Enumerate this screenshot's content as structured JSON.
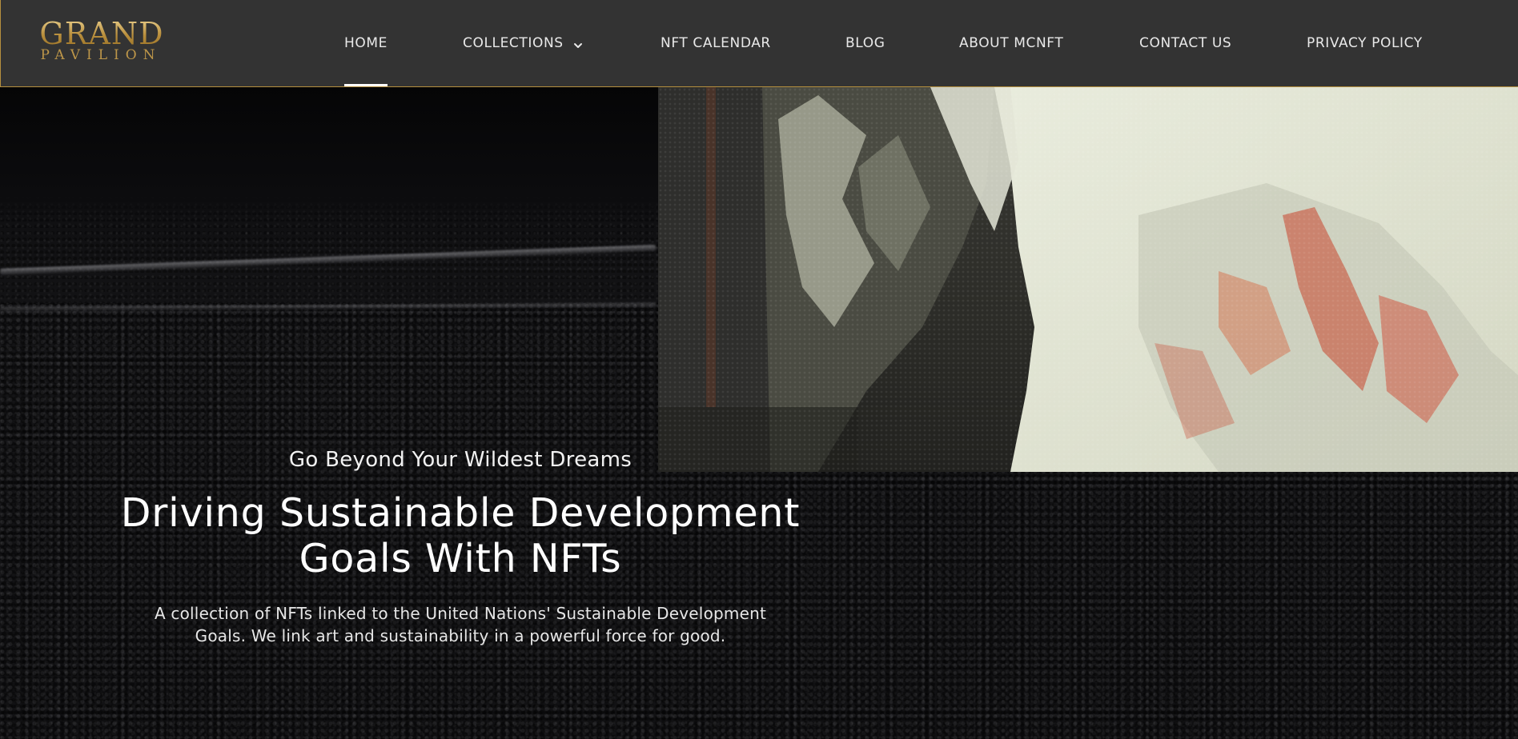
{
  "brand": {
    "logo_top": "GRAND",
    "logo_bottom": "PAVILION",
    "logo_color": "#c9a257"
  },
  "nav": {
    "items": [
      {
        "label": "HOME",
        "active": true
      },
      {
        "label": "COLLECTIONS",
        "has_dropdown": true,
        "icon": "chevron-down-icon"
      },
      {
        "label": "NFT CALENDAR"
      },
      {
        "label": "BLOG"
      },
      {
        "label": "ABOUT MCNFT"
      },
      {
        "label": "CONTACT US"
      },
      {
        "label": "PRIVACY POLICY"
      }
    ]
  },
  "hero": {
    "kicker": "Go Beyond Your Wildest Dreams",
    "headline": "Driving Sustainable Development Goals With NFTs",
    "description": "A collection of NFTs linked to the United Nations' Sustainable Development Goals. We link art and sustainability in a powerful force for good."
  },
  "colors": {
    "header_bg": "#333333",
    "accent_gold": "#b58f3e",
    "hero_bg": "#0d0d0f",
    "text": "#ffffff"
  }
}
